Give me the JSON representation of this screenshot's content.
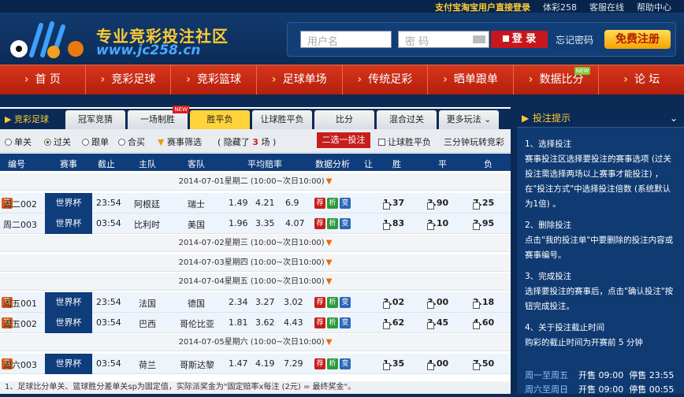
{
  "top_links": [
    "支付宝淘宝用户直接登录",
    "体彩258",
    "客服在线",
    "帮助中心"
  ],
  "header": {
    "slogan": "专业竞彩投注社区",
    "url": "www.jc258.cn",
    "username_ph": "用户名",
    "password_ph": "密 码",
    "login": "登 录",
    "forgot": "忘记密码",
    "register": "免费注册"
  },
  "nav": [
    "首 页",
    "竞彩足球",
    "竞彩篮球",
    "足球单场",
    "传统足彩",
    "晒单跟单",
    "数据比分",
    "论 坛"
  ],
  "nav_new": "NEW",
  "tabs": {
    "first": "竞彩足球",
    "items": [
      "冠军竞猜",
      "一场制胜",
      "胜平负",
      "让球胜平负",
      "比分",
      "混合过关",
      "更多玩法 ⌄"
    ],
    "new": "NEW"
  },
  "filter": {
    "single": "单关",
    "parlay": "过关",
    "follow": "跟单",
    "combine": "合买",
    "screen": "赛事筛选",
    "hidden_prefix": "( 隐藏了",
    "hidden_count": "3",
    "hidden_suffix": "场 )",
    "pick2": "二选一投注",
    "handicap": "让球胜平负",
    "three": "三分钟玩转竞彩"
  },
  "columns": [
    "编号",
    "赛事",
    "截止",
    "主队",
    "客队",
    "平均赔率",
    "数据分析",
    "让",
    "胜",
    "平",
    "负"
  ],
  "dates": [
    "2014-07-01星期二 (10:00~次日10:00)",
    "2014-07-02星期三 (10:00~次日10:00)",
    "2014-07-03星期四 (10:00~次日10:00)",
    "2014-07-04星期五 (10:00~次日10:00)",
    "2014-07-05星期六 (10:00~次日10:00)"
  ],
  "matches": [
    {
      "id": "周二002",
      "league": "世界杯",
      "time": "23:54",
      "home": "阿根廷",
      "away": "瑞士",
      "o1": "1.49",
      "o2": "4.21",
      "o3": "6.9",
      "w": "1.37",
      "d": "3.90",
      "l": "7.25"
    },
    {
      "id": "周二003",
      "league": "世界杯",
      "time": "03:54",
      "home": "比利时",
      "away": "美国",
      "o1": "1.96",
      "o2": "3.35",
      "o3": "4.07",
      "w": "1.83",
      "d": "3.10",
      "l": "3.95"
    },
    {
      "id": "周五001",
      "league": "世界杯",
      "time": "23:54",
      "home": "法国",
      "away": "德国",
      "o1": "2.34",
      "o2": "3.27",
      "o3": "3.02",
      "w": "3.02",
      "d": "3.00",
      "l": "2.18"
    },
    {
      "id": "周五002",
      "league": "世界杯",
      "time": "03:54",
      "home": "巴西",
      "away": "哥伦比亚",
      "o1": "1.81",
      "o2": "3.62",
      "o3": "4.43",
      "w": "1.62",
      "d": "3.45",
      "l": "4.60"
    },
    {
      "id": "周六003",
      "league": "世界杯",
      "time": "03:54",
      "home": "荷兰",
      "away": "哥斯达黎",
      "o1": "1.47",
      "o2": "4.19",
      "o3": "7.29",
      "w": "1.35",
      "d": "4.00",
      "l": "7.50"
    }
  ],
  "icons": {
    "recommend": "荐",
    "analyze": "析",
    "change": "变",
    "hot": "热"
  },
  "footnote": "1、足球比分单关、篮球胜分差单关sp为固定值，实际派奖金为\"固定赔率x每注 (2元) = 最终奖金\"。",
  "side": {
    "title": "投注提示",
    "s1t": "1、选择投注",
    "s1": "赛事投注区选择要投注的赛事选项 (过关投注需选择两场以上赛事才能投注) ，在\"投注方式\"中选择投注倍数 (系统默认为1倍) 。",
    "s2t": "2、删除投注",
    "s2": "点击\"我的投注单\"中要删除的投注内容或赛事编号。",
    "s3t": "3、完成投注",
    "s3": "选择要投注的赛事后，点击\"确认投注\"按钮完成投注。",
    "s4t": "4、关于投注截止时间",
    "s4": "购彩的截止时间为开赛前 5 分钟",
    "r1": {
      "days": "周一至周五",
      "open": "开售 09:00",
      "close": "停售 23:55"
    },
    "r2": {
      "days": "周六至周日",
      "open": "开售 09:00",
      "close": "停售 00:55"
    }
  }
}
